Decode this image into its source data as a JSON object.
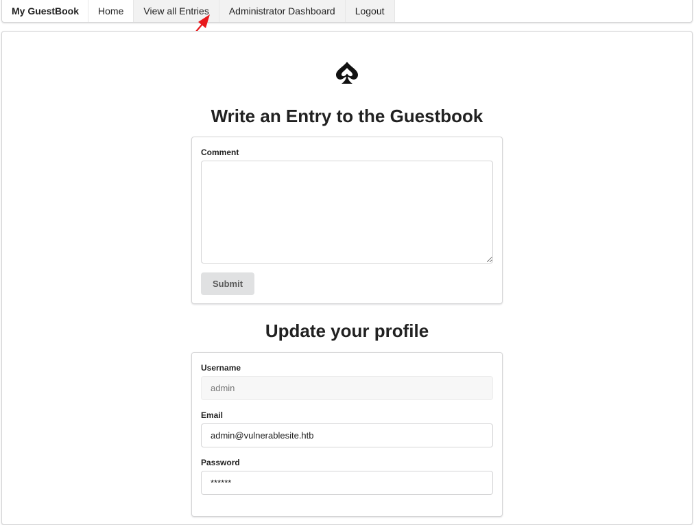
{
  "nav": {
    "brand": "My GuestBook",
    "items": [
      {
        "label": "Home"
      },
      {
        "label": "View all Entries"
      },
      {
        "label": "Administrator Dashboard"
      },
      {
        "label": "Logout"
      }
    ]
  },
  "annotation": {
    "icon": "red-arrow-icon",
    "color": "#e8191c"
  },
  "logo": {
    "icon": "spade-icon"
  },
  "entry_form": {
    "title": "Write an Entry to the Guestbook",
    "comment_label": "Comment",
    "comment_value": "",
    "submit_label": "Submit"
  },
  "profile_form": {
    "title": "Update your profile",
    "username_label": "Username",
    "username_placeholder": "admin",
    "email_label": "Email",
    "email_value": "admin@vulnerablesite.htb",
    "password_label": "Password",
    "password_value": "******"
  }
}
